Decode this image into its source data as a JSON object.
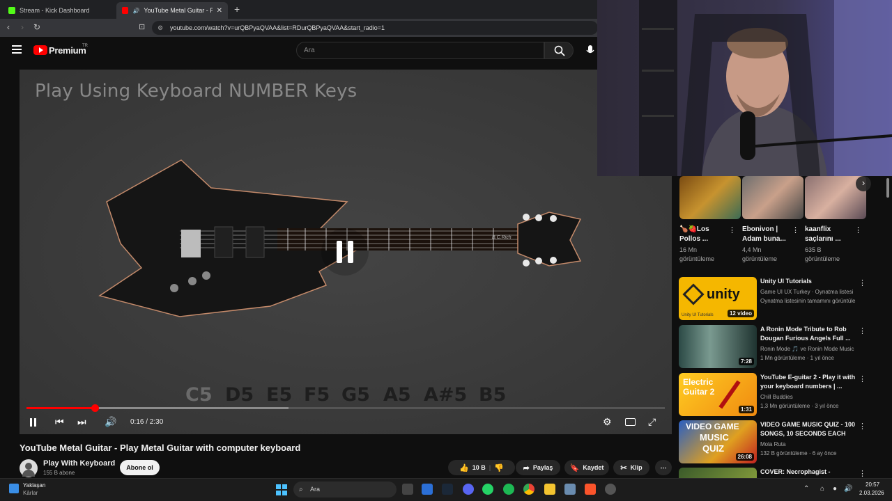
{
  "browser": {
    "tabs": [
      {
        "title": "Stream - Kick Dashboard",
        "active": false
      },
      {
        "title": "YouTube Metal Guitar - Play M",
        "active": true
      }
    ],
    "new_tab": "+",
    "url": "youtube.com/watch?v=urQBPyaQVAA&list=RDurQBPyaQVAA&start_radio=1"
  },
  "yt_header": {
    "logo": "Premium",
    "region": "TR",
    "search_placeholder": "Ara"
  },
  "player": {
    "overlay_title": "Play Using Keyboard NUMBER Keys",
    "notes": [
      "C5",
      "D5",
      "E5",
      "F5",
      "G5",
      "A5",
      "A#5",
      "B5"
    ],
    "guitar_brand": "B.C.Rich",
    "time": "0:16 / 2:30",
    "progress_fraction": 0.107,
    "buffered_fraction": 0.41
  },
  "video": {
    "title": "YouTube Metal Guitar - Play Metal Guitar with computer keyboard",
    "channel": "Play With Keyboard",
    "subscribers": "155 B abone",
    "subscribe_label": "Abone ol",
    "likes": "10 B",
    "share_label": "Paylaş",
    "save_label": "Kaydet",
    "clip_label": "Klip"
  },
  "shorts": [
    {
      "title_line1": "🍗🍓Los",
      "title_line2": "Pollos ...",
      "views1": "16 Mn",
      "views2": "görüntüleme"
    },
    {
      "title_line1": "Ebonivon |",
      "title_line2": "Adam buna...",
      "views1": "4,4 Mn",
      "views2": "görüntüleme"
    },
    {
      "title_line1": "kaanflix",
      "title_line2": "saçlarını ...",
      "views1": "635 B",
      "views2": "görüntüleme"
    }
  ],
  "recommendations": [
    {
      "title1": "Unity UI Tutorials",
      "title2": "",
      "meta1": "Game UI UX Turkey · Oynatma listesi",
      "meta2": "Oynatma listesinin tamamını görüntüle",
      "badge": "12 video"
    },
    {
      "title1": "A Ronin Mode Tribute to Rob",
      "title2": "Dougan Furious Angels Full ...",
      "meta1": "Ronin Mode 🎵 ve Ronin Mode Music",
      "meta2": "1 Mn görüntüleme · 1 yıl önce",
      "badge": "7:28"
    },
    {
      "title1": "YouTube E-guitar 2 - Play it with",
      "title2": "your keyboard numbers | ...",
      "meta1": "Chill Buddies",
      "meta2": "1,3 Mn görüntüleme · 3 yıl önce",
      "badge": "1:31"
    },
    {
      "title1": "VIDEO GAME MUSIC QUIZ - 100",
      "title2": "SONGS, 10 SECONDS EACH",
      "meta1": "Mola Ruta",
      "meta2": "132 B görüntüleme · 6 ay önce",
      "badge": "26:08"
    },
    {
      "title1": "COVER: Necrophagist -",
      "title2": "",
      "meta1": "",
      "meta2": "",
      "badge": ""
    }
  ],
  "thumb_text": {
    "unity": "unity",
    "unity_sub": "Unity UI Tutorials",
    "eguitar1": "Electric",
    "eguitar2": "Guitar 2",
    "quiz1": "VIDEO GAME",
    "quiz2": "MUSIC",
    "quiz3": "QUIZ"
  },
  "taskbar": {
    "weather1": "Yaklaşan",
    "weather2": "Kârlar",
    "search": "Ara",
    "time": "20:57",
    "date": "2.03.2026"
  }
}
